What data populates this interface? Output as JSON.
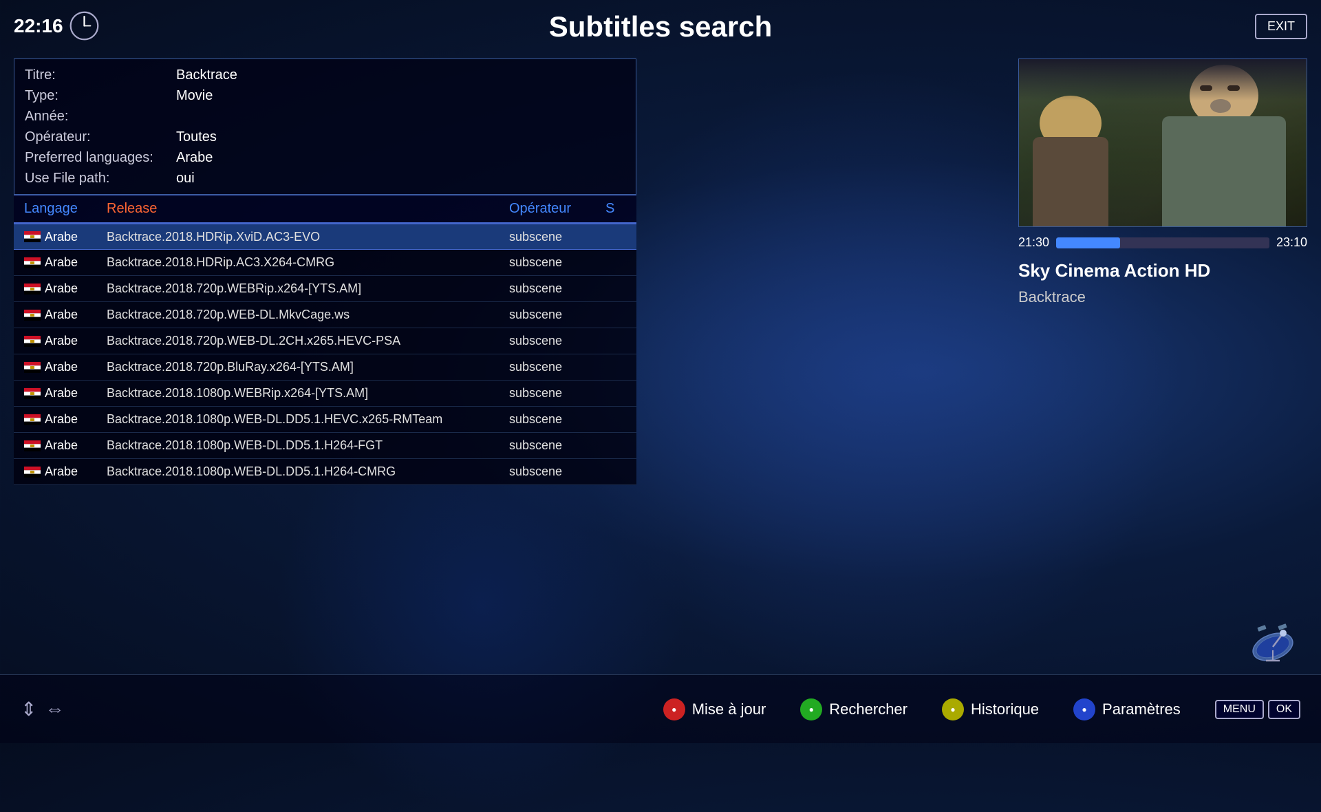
{
  "page": {
    "title": "Subtitles search"
  },
  "clock": {
    "time": "22:16"
  },
  "exit_button": {
    "label": "EXIT"
  },
  "info": {
    "titre_label": "Titre:",
    "titre_value": "Backtrace",
    "type_label": "Type:",
    "type_value": "Movie",
    "annee_label": "Année:",
    "annee_value": "",
    "operateur_label": "Opérateur:",
    "operateur_value": "Toutes",
    "languages_label": "Preferred languages:",
    "languages_value": "Arabe",
    "filepath_label": "Use File path:",
    "filepath_value": "oui"
  },
  "table": {
    "col_langage": "Langage",
    "col_release": "Release",
    "col_operateur": "Opérateur",
    "col_s": "S",
    "rows": [
      {
        "langage": "Arabe",
        "release": "Backtrace.2018.HDRip.XviD.AC3-EVO",
        "operateur": "subscene",
        "selected": true
      },
      {
        "langage": "Arabe",
        "release": "Backtrace.2018.HDRip.AC3.X264-CMRG",
        "operateur": "subscene",
        "selected": false
      },
      {
        "langage": "Arabe",
        "release": "Backtrace.2018.720p.WEBRip.x264-[YTS.AM]",
        "operateur": "subscene",
        "selected": false
      },
      {
        "langage": "Arabe",
        "release": "Backtrace.2018.720p.WEB-DL.MkvCage.ws",
        "operateur": "subscene",
        "selected": false
      },
      {
        "langage": "Arabe",
        "release": "Backtrace.2018.720p.WEB-DL.2CH.x265.HEVC-PSA",
        "operateur": "subscene",
        "selected": false
      },
      {
        "langage": "Arabe",
        "release": "Backtrace.2018.720p.BluRay.x264-[YTS.AM]",
        "operateur": "subscene",
        "selected": false
      },
      {
        "langage": "Arabe",
        "release": "Backtrace.2018.1080p.WEBRip.x264-[YTS.AM]",
        "operateur": "subscene",
        "selected": false
      },
      {
        "langage": "Arabe",
        "release": "Backtrace.2018.1080p.WEB-DL.DD5.1.HEVC.x265-RMTeam",
        "operateur": "subscene",
        "selected": false
      },
      {
        "langage": "Arabe",
        "release": "Backtrace.2018.1080p.WEB-DL.DD5.1.H264-FGT",
        "operateur": "subscene",
        "selected": false
      },
      {
        "langage": "Arabe",
        "release": "Backtrace.2018.1080p.WEB-DL.DD5.1.H264-CMRG",
        "operateur": "subscene",
        "selected": false
      }
    ]
  },
  "right_panel": {
    "progress_start": "21:30",
    "progress_end": "23:10",
    "progress_percent": 30,
    "channel": "Sky Cinema Action HD",
    "movie_title": "Backtrace"
  },
  "bottom_bar": {
    "action1_label": "Mise à jour",
    "action2_label": "Rechercher",
    "action3_label": "Historique",
    "action4_label": "Paramètres",
    "menu_label": "MENU",
    "ok_label": "OK"
  }
}
